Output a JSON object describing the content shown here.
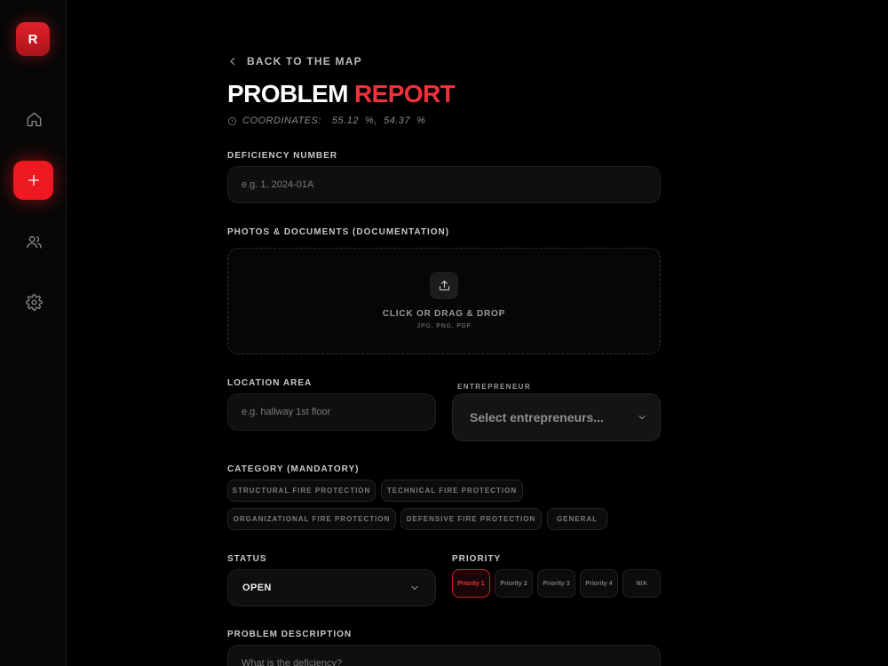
{
  "sidebar": {
    "logo_letter": "R",
    "items": [
      {
        "icon": "home-icon"
      },
      {
        "icon": "plus-icon"
      },
      {
        "icon": "users-icon"
      },
      {
        "icon": "gear-icon"
      }
    ]
  },
  "header": {
    "back_label": "BACK TO THE MAP",
    "title_part1": "PROBLEM",
    "title_part2": "REPORT",
    "coords_label": "COORDINATES:",
    "coords_value": "55.12  %,  54.37  %"
  },
  "form": {
    "deficiency_number": {
      "label": "DEFICIENCY NUMBER",
      "placeholder": "e.g. 1, 2024-01A",
      "value": ""
    },
    "photos": {
      "label": "PHOTOS & DOCUMENTS (DOCUMENTATION)",
      "prompt": "CLICK OR DRAG & DROP",
      "formats": "JPG, PNG, PDF"
    },
    "location_area": {
      "label": "LOCATION AREA",
      "placeholder": "e.g. hallway 1st floor",
      "value": ""
    },
    "entrepreneur": {
      "label": "ENTREPRENEUR",
      "placeholder": "Select entrepreneurs..."
    },
    "category": {
      "label": "CATEGORY (MANDATORY)",
      "options": [
        "STRUCTURAL FIRE PROTECTION",
        "TECHNICAL FIRE PROTECTION",
        "ORGANIZATIONAL FIRE PROTECTION",
        "DEFENSIVE FIRE PROTECTION",
        "GENERAL"
      ]
    },
    "status": {
      "label": "STATUS",
      "value": "OPEN"
    },
    "priority": {
      "label": "PRIORITY",
      "options": [
        "Priority 1",
        "Priority 2",
        "Priority 3",
        "Priority 4",
        "N/A"
      ],
      "selected": "Priority 1"
    },
    "description": {
      "label": "PROBLEM DESCRIPTION",
      "placeholder": "What is the deficiency?"
    }
  },
  "colors": {
    "accent": "#ee1820",
    "background": "#000000"
  }
}
